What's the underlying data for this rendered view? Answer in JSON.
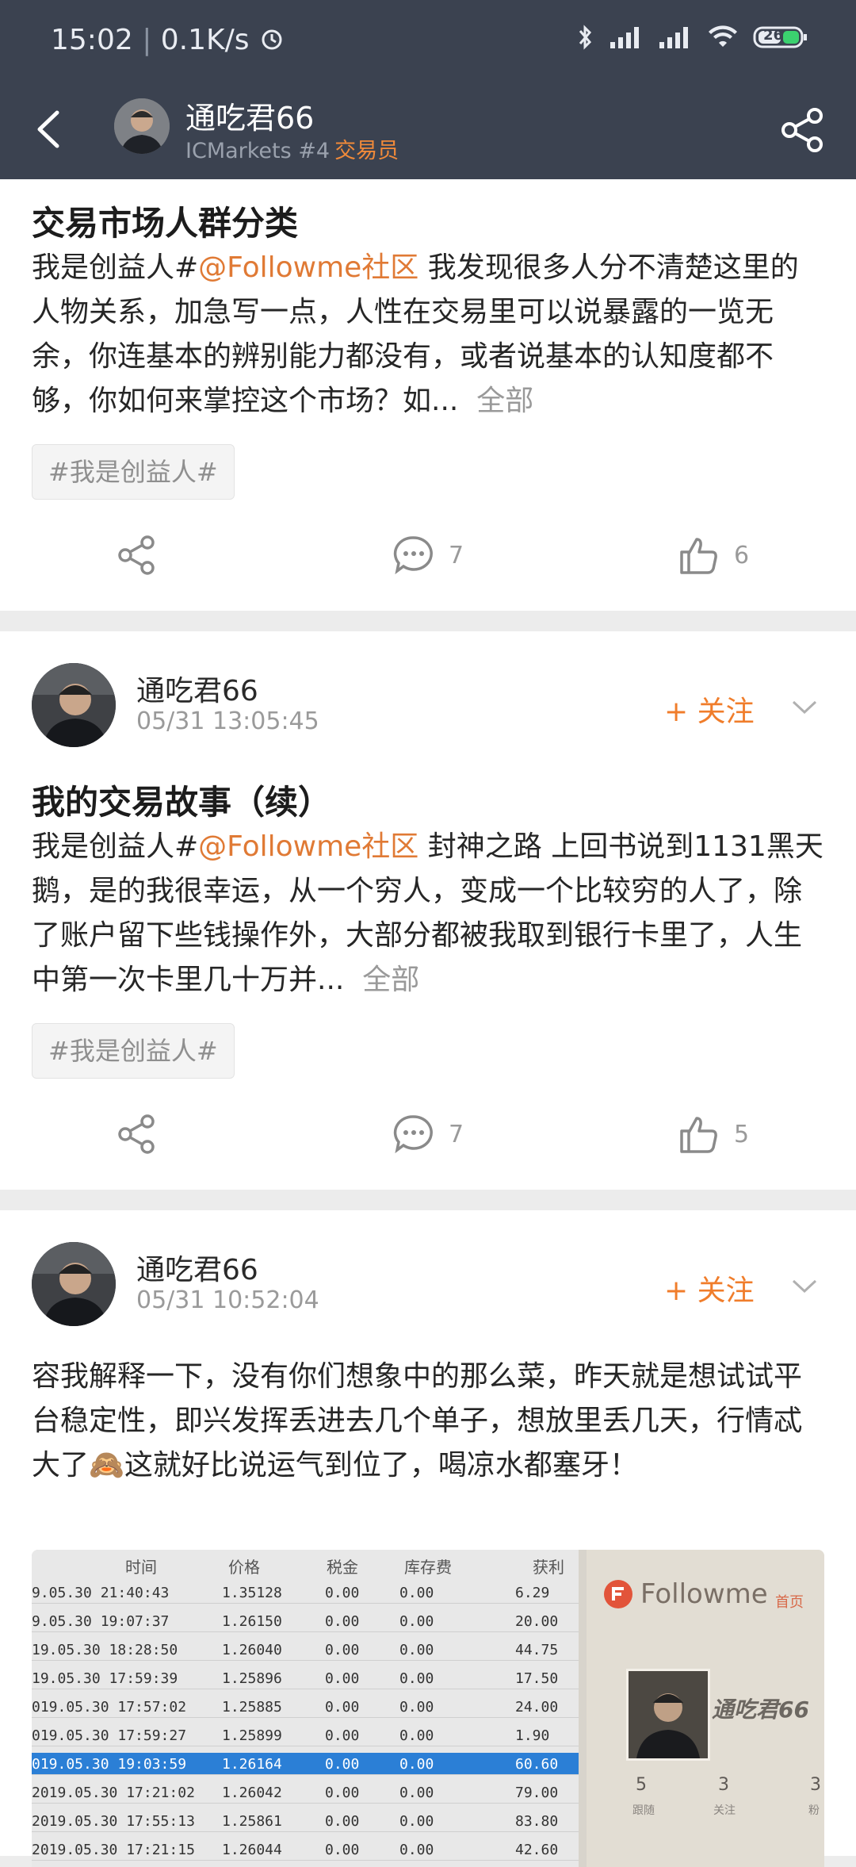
{
  "status": {
    "time": "15:02",
    "speed": "0.1K/s",
    "battery": "26"
  },
  "header": {
    "name": "通吃君66",
    "sub": "ICMarkets #4",
    "role": "交易员"
  },
  "post1": {
    "title": "交易市场人群分类",
    "text_a": " 我是创益人#",
    "mention": "@Followme社区",
    "text_b": " 我发现很多人分不清楚这里的人物关系，加急写一点，人性在交易里可以说暴露的一览无余，你连基本的辨别能力都没有，或者说基本的认知度都不够，你如何来掌控这个市场？如...",
    "more": "全部",
    "tag": "#我是创益人#",
    "comments": "7",
    "likes": "6"
  },
  "post2": {
    "author": "通吃君66",
    "time": "05/31 13:05:45",
    "follow": "+ 关注",
    "title": "我的交易故事（续）",
    "text_a": "我是创益人#",
    "mention": "@Followme社区",
    "text_b": " 封神之路 上回书说到1131黑天鹅，是的我很幸运，从一个穷人，变成一个比较穷的人了，除了账户留下些钱操作外，大部分都被我取到银行卡里了，人生中第一次卡里几十万并...",
    "more": "全部",
    "tag": "#我是创益人#",
    "comments": "7",
    "likes": "5"
  },
  "post3": {
    "author": "通吃君66",
    "time": "05/31 10:52:04",
    "follow": "+ 关注",
    "text_a": "容我解释一下，没有你们想象中的那么菜，昨天就是想试试平台稳定性，即兴发挥丢进去几个单子，想放里丢几天，行情忒大了",
    "emoji": "🙈",
    "text_b": "这就好比说运气到位了，喝凉水都塞牙！"
  },
  "photo": {
    "headers": [
      "时间",
      "价格",
      "税金",
      "库存费",
      "获利"
    ],
    "rows": [
      [
        "9.05.30 21:40:43",
        "1.35128",
        "0.00",
        "0.00",
        "6.29"
      ],
      [
        "9.05.30 19:07:37",
        "1.26150",
        "0.00",
        "0.00",
        "20.00"
      ],
      [
        "19.05.30 18:28:50",
        "1.26040",
        "0.00",
        "0.00",
        "44.75"
      ],
      [
        "19.05.30 17:59:39",
        "1.25896",
        "0.00",
        "0.00",
        "17.50"
      ],
      [
        "019.05.30 17:57:02",
        "1.25885",
        "0.00",
        "0.00",
        "24.00"
      ],
      [
        "019.05.30 17:59:27",
        "1.25899",
        "0.00",
        "0.00",
        "1.90"
      ],
      [
        "019.05.30 19:03:59",
        "1.26164",
        "0.00",
        "0.00",
        "60.60"
      ],
      [
        "2019.05.30 17:21:02",
        "1.26042",
        "0.00",
        "0.00",
        "79.00"
      ],
      [
        "2019.05.30 17:55:13",
        "1.25861",
        "0.00",
        "0.00",
        "83.80"
      ],
      [
        "2019.05.30 17:21:15",
        "1.26044",
        "0.00",
        "0.00",
        "42.60"
      ]
    ],
    "brand": "Followme",
    "home": "首页",
    "profile_name": "通吃君66",
    "stats": [
      "5",
      "3",
      "3"
    ],
    "stat_labels": [
      "跟随",
      "关注",
      "粉"
    ]
  }
}
